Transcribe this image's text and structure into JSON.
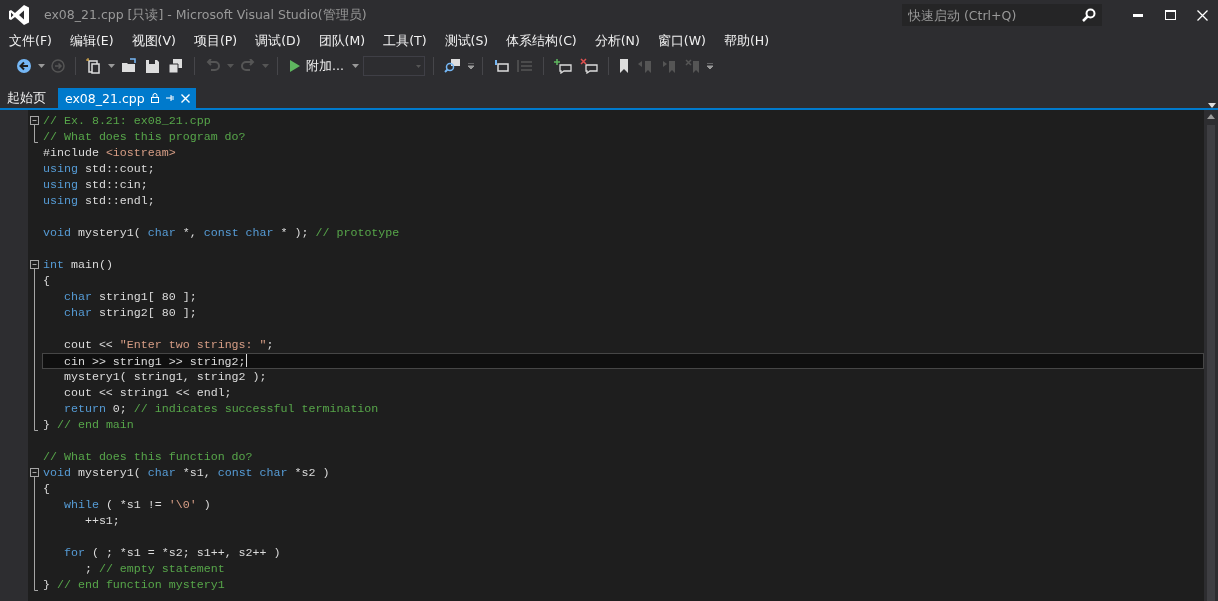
{
  "window": {
    "title": "ex08_21.cpp [只读] - Microsoft Visual Studio(管理员)",
    "quick_launch": {
      "placeholder": "快速启动 (Ctrl+Q)"
    }
  },
  "menu": [
    "文件(F)",
    "编辑(E)",
    "视图(V)",
    "项目(P)",
    "调试(D)",
    "团队(M)",
    "工具(T)",
    "测试(S)",
    "体系结构(C)",
    "分析(N)",
    "窗口(W)",
    "帮助(H)"
  ],
  "toolbar": {
    "attach_button": "附加...",
    "config_combo": {
      "disabled": true
    }
  },
  "tabs": [
    {
      "label": "起始页",
      "selected": false,
      "pinned": false
    },
    {
      "label": "ex08_21.cpp",
      "selected": true,
      "pinned": true
    }
  ],
  "code_lines": [
    {
      "kind": "fold_start",
      "current": false,
      "tokens": [
        {
          "kind": "cm",
          "text": "// Ex. 8.21: ex08_21.cpp"
        }
      ]
    },
    {
      "kind": "fold_end",
      "current": false,
      "tokens": [
        {
          "kind": "cm",
          "text": "// What does this program do?"
        }
      ]
    },
    {
      "kind": "plain",
      "current": false,
      "tokens": [
        {
          "kind": "tx",
          "text": "#include"
        },
        {
          "kind": "st",
          "text": " <iostream>"
        }
      ]
    },
    {
      "kind": "plain",
      "current": false,
      "tokens": [
        {
          "kind": "kw",
          "text": "using"
        },
        {
          "kind": "tx",
          "text": " std::cout;"
        }
      ]
    },
    {
      "kind": "plain",
      "current": false,
      "tokens": [
        {
          "kind": "kw",
          "text": "using"
        },
        {
          "kind": "tx",
          "text": " std::cin;"
        }
      ]
    },
    {
      "kind": "plain",
      "current": false,
      "tokens": [
        {
          "kind": "kw",
          "text": "using"
        },
        {
          "kind": "tx",
          "text": " std::endl;"
        }
      ]
    },
    {
      "kind": "plain",
      "current": false
    },
    {
      "kind": "plain",
      "current": false,
      "tokens": [
        {
          "kind": "kw",
          "text": "void"
        },
        {
          "kind": "tx",
          "text": " mystery1("
        },
        {
          "kind": "kw",
          "text": " char"
        },
        {
          "kind": "tx",
          "text": " *,"
        },
        {
          "kind": "kw",
          "text": " const char"
        },
        {
          "kind": "tx",
          "text": " * );"
        },
        {
          "kind": "cm",
          "text": " // prototype"
        }
      ]
    },
    {
      "kind": "plain",
      "current": false
    },
    {
      "kind": "fold_start",
      "current": false,
      "tokens": [
        {
          "kind": "kw",
          "text": "int"
        },
        {
          "kind": "tx",
          "text": " main()"
        }
      ]
    },
    {
      "kind": "fold_body",
      "current": false,
      "tokens": [
        {
          "kind": "tx",
          "text": "{"
        }
      ]
    },
    {
      "kind": "fold_body",
      "current": false,
      "tokens": [
        {
          "kind": "kw",
          "text": "   char"
        },
        {
          "kind": "tx",
          "text": " string1[ 80 ];"
        }
      ]
    },
    {
      "kind": "fold_body",
      "current": false,
      "tokens": [
        {
          "kind": "kw",
          "text": "   char"
        },
        {
          "kind": "tx",
          "text": " string2[ 80 ];"
        }
      ]
    },
    {
      "kind": "fold_body",
      "current": false
    },
    {
      "kind": "fold_body",
      "current": false,
      "tokens": [
        {
          "kind": "tx",
          "text": "   cout <<"
        },
        {
          "kind": "st",
          "text": " \"Enter two strings: \""
        },
        {
          "kind": "tx",
          "text": ";"
        }
      ]
    },
    {
      "kind": "fold_body",
      "current": true,
      "tokens": [
        {
          "kind": "tx",
          "text": "   cin >> string1 >> string2;"
        }
      ]
    },
    {
      "kind": "fold_body",
      "current": false,
      "tokens": [
        {
          "kind": "tx",
          "text": "   mystery1( string1, string2 );"
        }
      ]
    },
    {
      "kind": "fold_body",
      "current": false,
      "tokens": [
        {
          "kind": "tx",
          "text": "   cout << string1 << endl;"
        }
      ]
    },
    {
      "kind": "fold_body",
      "current": false,
      "tokens": [
        {
          "kind": "kw",
          "text": "   return"
        },
        {
          "kind": "tx",
          "text": " 0;"
        },
        {
          "kind": "cm",
          "text": " // indicates successful termination"
        }
      ]
    },
    {
      "kind": "fold_end",
      "current": false,
      "tokens": [
        {
          "kind": "tx",
          "text": "}"
        },
        {
          "kind": "cm",
          "text": " // end main"
        }
      ]
    },
    {
      "kind": "plain",
      "current": false
    },
    {
      "kind": "plain",
      "current": false,
      "tokens": [
        {
          "kind": "cm",
          "text": "// What does this function do?"
        }
      ]
    },
    {
      "kind": "fold_start",
      "current": false,
      "tokens": [
        {
          "kind": "kw",
          "text": "void"
        },
        {
          "kind": "tx",
          "text": " mystery1("
        },
        {
          "kind": "kw",
          "text": " char"
        },
        {
          "kind": "tx",
          "text": " *s1,"
        },
        {
          "kind": "kw",
          "text": " const char"
        },
        {
          "kind": "tx",
          "text": " *s2 )"
        }
      ]
    },
    {
      "kind": "fold_body",
      "current": false,
      "tokens": [
        {
          "kind": "tx",
          "text": "{"
        }
      ]
    },
    {
      "kind": "fold_body",
      "current": false,
      "tokens": [
        {
          "kind": "kw",
          "text": "   while"
        },
        {
          "kind": "tx",
          "text": " ( *s1 !="
        },
        {
          "kind": "st",
          "text": " '\\0'"
        },
        {
          "kind": "tx",
          "text": " )"
        }
      ]
    },
    {
      "kind": "fold_body",
      "current": false,
      "tokens": [
        {
          "kind": "tx",
          "text": "      ++s1;"
        }
      ]
    },
    {
      "kind": "fold_body",
      "current": false
    },
    {
      "kind": "fold_body",
      "current": false,
      "tokens": [
        {
          "kind": "kw",
          "text": "   for"
        },
        {
          "kind": "tx",
          "text": " ( ; *s1 = *s2; s1++, s2++ )"
        }
      ]
    },
    {
      "kind": "fold_body",
      "current": false,
      "tokens": [
        {
          "kind": "tx",
          "text": "      ;"
        },
        {
          "kind": "cm",
          "text": " // empty statement"
        }
      ]
    },
    {
      "kind": "fold_end",
      "current": false,
      "tokens": [
        {
          "kind": "tx",
          "text": "}"
        },
        {
          "kind": "cm",
          "text": " // end function mystery1"
        }
      ]
    }
  ]
}
